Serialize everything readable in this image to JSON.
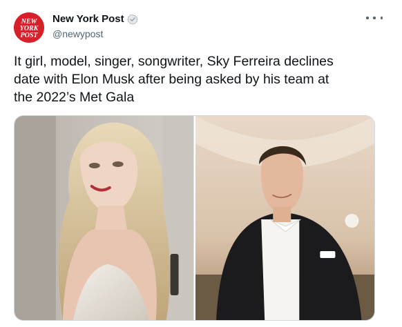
{
  "account": {
    "display_name": "New York Post",
    "handle": "@newypost",
    "avatar_logo_text": [
      "NEW",
      "YORK",
      "POST"
    ]
  },
  "tweet": {
    "text_lines": [
      "It girl, model, singer, songwriter, Sky Ferreira declines",
      "date with Elon Musk after being asked by his team at",
      "the 2022’s Met Gala"
    ]
  },
  "icons": {
    "verified": "verified-badge-icon",
    "more": "more-options-icon"
  },
  "colors": {
    "brand_red": "#d6202a",
    "text_primary": "#0f1419",
    "text_secondary": "#536471",
    "border": "#cfd9de"
  }
}
